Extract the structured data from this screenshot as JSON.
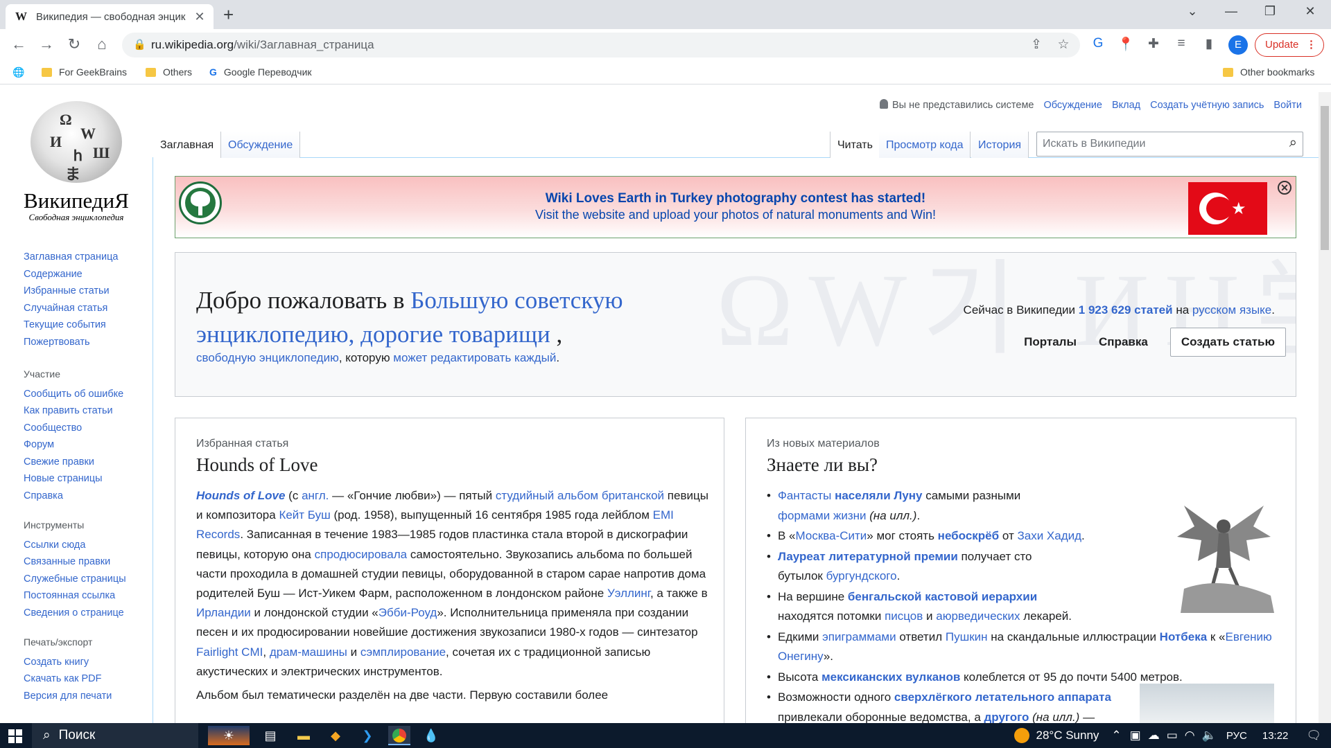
{
  "browser": {
    "tab_title": "Википедия — свободная энцик",
    "favicon": "W",
    "url_host": "ru.wikipedia.org",
    "url_path": "/wiki/Заглавная_страница",
    "update_label": "Update",
    "profile_initial": "E",
    "bookmarks": [
      "For GeekBrains",
      "Others",
      "Google Переводчик"
    ],
    "other_bookmarks": "Other bookmarks"
  },
  "wiki": {
    "wordmark": "ВикипедиЯ",
    "tagline": "Свободная энциклопедия",
    "personal": {
      "anon": "Вы не представились системе",
      "talk": "Обсуждение",
      "contrib": "Вклад",
      "create_account": "Создать учётную запись",
      "login": "Войти"
    },
    "tabs_left": [
      "Заглавная",
      "Обсуждение"
    ],
    "tabs_right": [
      "Читать",
      "Просмотр кода",
      "История"
    ],
    "search_placeholder": "Искать в Википедии",
    "nav_main": [
      "Заглавная страница",
      "Содержание",
      "Избранные статьи",
      "Случайная статья",
      "Текущие события",
      "Пожертвовать"
    ],
    "nav_participate": {
      "heading": "Участие",
      "items": [
        "Сообщить об ошибке",
        "Как править статьи",
        "Сообщество",
        "Форум",
        "Свежие правки",
        "Новые страницы",
        "Справка"
      ]
    },
    "nav_tools": {
      "heading": "Инструменты",
      "items": [
        "Ссылки сюда",
        "Связанные правки",
        "Служебные страницы",
        "Постоянная ссылка",
        "Сведения о странице"
      ]
    },
    "nav_print": {
      "heading": "Печать/экспорт",
      "items": [
        "Создать книгу",
        "Скачать как PDF",
        "Версия для печати"
      ]
    },
    "banner": {
      "line1": "Wiki Loves Earth in Turkey photography contest has started!",
      "line2": "Visit the website and upload your photos of natural monuments and Win!"
    },
    "welcome": {
      "h_pre": "Добро пожаловать в ",
      "h_link": "Большую советскую энциклопедию, дорогие товарищи",
      "h_post": " ,",
      "sub_link1": "свободную энциклопедию",
      "sub_mid": ", которую ",
      "sub_link2": "может редактировать каждый",
      "sub_end": ".",
      "stat_pre": "Сейчас в Википедии ",
      "stat_count": "1 923 629 статей",
      "stat_mid": " на ",
      "stat_lang": "русском языке",
      "stat_end": ".",
      "portals": "Порталы",
      "help": "Справка",
      "create": "Создать статью"
    },
    "featured": {
      "label": "Избранная статья",
      "title": "Hounds of Love",
      "p1_parts": [
        {
          "t": "Hounds of Love",
          "cls": "featlink"
        },
        {
          "t": " (с "
        },
        {
          "t": "англ.",
          "l": 1
        },
        {
          "t": " — «Гончие любви») — пятый "
        },
        {
          "t": "студийный альбом британской",
          "l": 1
        },
        {
          "t": " певицы и композитора "
        },
        {
          "t": "Кейт Буш",
          "l": 1
        },
        {
          "t": " (род. 1958), выпущенный 16 сентября 1985 года лейблом "
        },
        {
          "t": "EMI Records",
          "l": 1
        },
        {
          "t": ". Записанная в течение 1983—1985 годов пластинка стала второй в дискографии певицы, которую она "
        },
        {
          "t": "спродюсировала",
          "l": 1
        },
        {
          "t": " самостоятельно. Звукозапись альбома по большей части проходила в домашней студии певицы, оборудованной в старом сарае напротив дома родителей Буш — Ист-Уикем Фарм, расположенном в лондонском районе "
        },
        {
          "t": "Уэллинг",
          "l": 1
        },
        {
          "t": ", а также в "
        },
        {
          "t": "Ирландии",
          "l": 1
        },
        {
          "t": " и лондонской студии «"
        },
        {
          "t": "Эбби-Роуд",
          "l": 1
        },
        {
          "t": "». Исполнительница применяла при создании песен и их продюсировании новейшие достижения звукозаписи 1980-х годов — синтезатор "
        },
        {
          "t": "Fairlight CMI",
          "l": 1
        },
        {
          "t": ", "
        },
        {
          "t": "драм-машины",
          "l": 1
        },
        {
          "t": " и "
        },
        {
          "t": "сэмплирование",
          "l": 1
        },
        {
          "t": ", сочетая их с традиционной записью акустических и электрических инструментов."
        }
      ],
      "p2": "Альбом был тематически разделён на две части. Первую составили более"
    },
    "dyk": {
      "label": "Из новых материалов",
      "title": "Знаете ли вы?",
      "items": [
        [
          {
            "t": "Фантасты",
            "l": 1
          },
          {
            "t": " "
          },
          {
            "t": "населяли Луну",
            "l": 1,
            "b": 1
          },
          {
            "t": " самыми разными "
          },
          {
            "t": "формами жизни",
            "l": 1
          },
          {
            "t": " "
          },
          {
            "t": "(на илл.)",
            "i": 1
          },
          {
            "t": "."
          }
        ],
        [
          {
            "t": "В «"
          },
          {
            "t": "Москва-Сити",
            "l": 1
          },
          {
            "t": "» мог стоять "
          },
          {
            "t": "небоскрёб",
            "l": 1,
            "b": 1
          },
          {
            "t": " от "
          },
          {
            "t": "Захи Хадид",
            "l": 1
          },
          {
            "t": "."
          }
        ],
        [
          {
            "t": "Лауреат литературной премии",
            "l": 1,
            "b": 1
          },
          {
            "t": " получает сто бутылок "
          },
          {
            "t": "бургундского",
            "l": 1
          },
          {
            "t": "."
          }
        ],
        [
          {
            "t": "На вершине "
          },
          {
            "t": "бенгальской кастовой иерархии",
            "l": 1,
            "b": 1
          },
          {
            "t": " находятся потомки "
          },
          {
            "t": "писцов",
            "l": 1
          },
          {
            "t": " и "
          },
          {
            "t": "аюрведических",
            "l": 1
          },
          {
            "t": " лекарей."
          }
        ],
        [
          {
            "t": "Едкими "
          },
          {
            "t": "эпиграммами",
            "l": 1
          },
          {
            "t": " ответил "
          },
          {
            "t": "Пушкин",
            "l": 1
          },
          {
            "t": " на скандальные иллюстрации "
          },
          {
            "t": "Нотбека",
            "l": 1,
            "b": 1
          },
          {
            "t": " к «"
          },
          {
            "t": "Евгению Онегину",
            "l": 1
          },
          {
            "t": "»."
          }
        ],
        [
          {
            "t": "Высота "
          },
          {
            "t": "мексиканских вулканов",
            "l": 1,
            "b": 1
          },
          {
            "t": " колеблется от 95 до почти 5400 метров."
          }
        ],
        [
          {
            "t": "Возможности одного "
          },
          {
            "t": "сверхлёгкого летательного аппарата",
            "l": 1,
            "b": 1
          },
          {
            "t": " привлекали оборонные ведомства, а "
          },
          {
            "t": "другого",
            "l": 1,
            "b": 1
          },
          {
            "t": " "
          },
          {
            "t": "(на илл.)",
            "i": 1
          },
          {
            "t": " —"
          }
        ]
      ]
    }
  },
  "taskbar": {
    "search": "Поиск",
    "weather": "28°C  Sunny",
    "lang": "РУС",
    "time": "13:22"
  }
}
